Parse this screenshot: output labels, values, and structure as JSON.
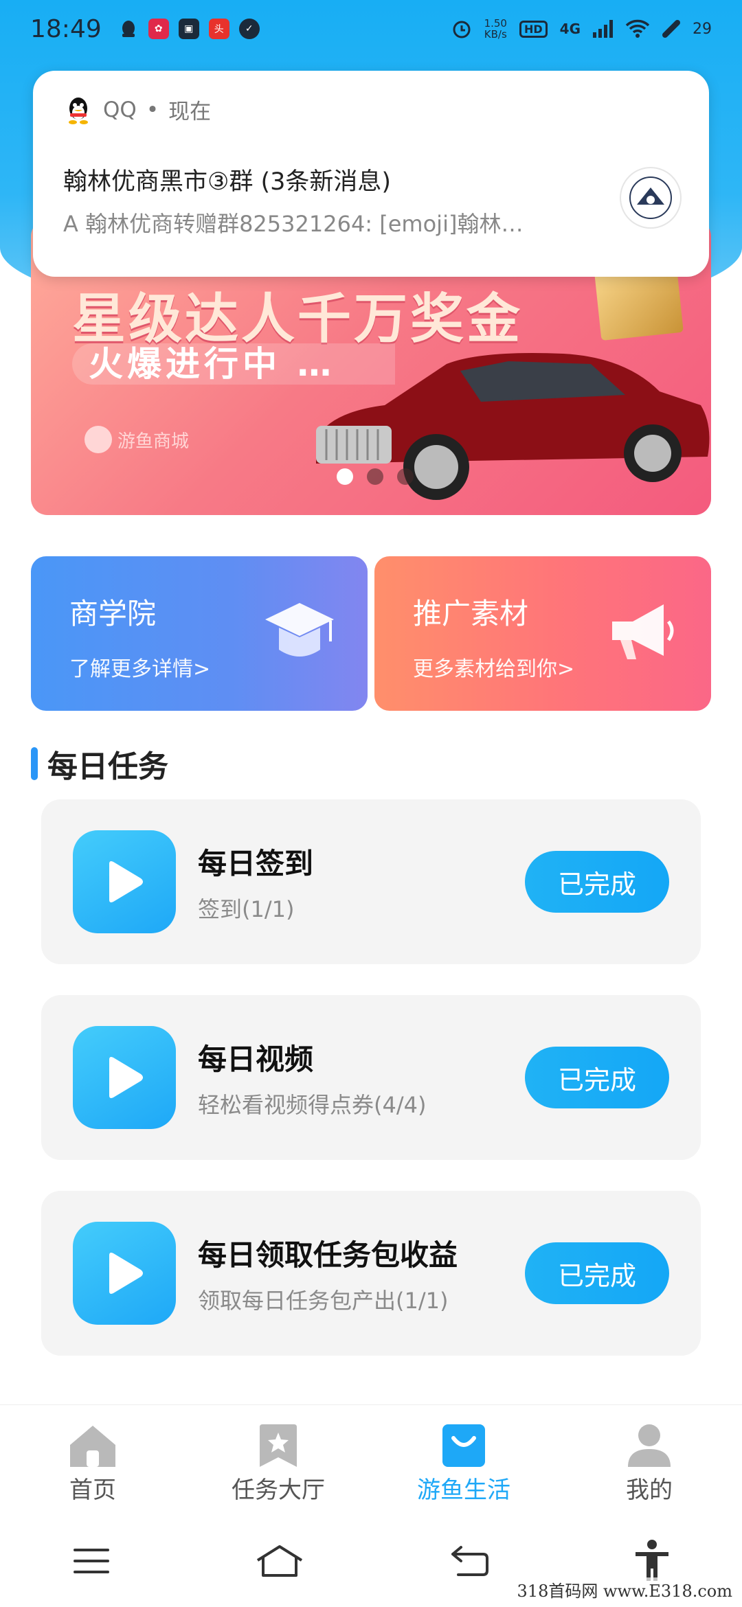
{
  "status_bar": {
    "time": "18:49",
    "speed_value": "1.50",
    "speed_unit": "KB/s",
    "hd": "HD",
    "network": "4G",
    "battery": "29"
  },
  "notification": {
    "app": "QQ",
    "separator": "•",
    "when": "现在",
    "title": "翰林优商黑市③群 (3条新消息)",
    "body": "A 翰林优商转赠群825321264: [emoji]翰林…"
  },
  "banner": {
    "title": "星级达人千万奖金",
    "subtitle": "火爆进行中 …",
    "logo_text": "游鱼商城",
    "slides": 3,
    "active_slide": 1
  },
  "quick_cards": [
    {
      "title": "商学院",
      "subtitle": "了解更多详情>",
      "icon": "graduation-cap-icon"
    },
    {
      "title": "推广素材",
      "subtitle": "更多素材给到你>",
      "icon": "megaphone-icon"
    }
  ],
  "section": {
    "title": "每日任务"
  },
  "tasks": [
    {
      "title": "每日签到",
      "subtitle": "签到(1/1)",
      "button": "已完成"
    },
    {
      "title": "每日视频",
      "subtitle": "轻松看视频得点券(4/4)",
      "button": "已完成"
    },
    {
      "title": "每日领取任务包收益",
      "subtitle": "领取每日任务包产出(1/1)",
      "button": "已完成"
    }
  ],
  "bottom_nav": [
    {
      "label": "首页",
      "icon": "home-icon",
      "active": false
    },
    {
      "label": "任务大厅",
      "icon": "star-bookmark-icon",
      "active": false
    },
    {
      "label": "游鱼生活",
      "icon": "shopping-bag-icon",
      "active": true
    },
    {
      "label": "我的",
      "icon": "user-icon",
      "active": false
    }
  ],
  "watermark": "318首码网 www.E318.com",
  "colors": {
    "accent": "#1ea8f7",
    "blue_card": "#5f8ef3",
    "red_card": "#ff7579"
  }
}
